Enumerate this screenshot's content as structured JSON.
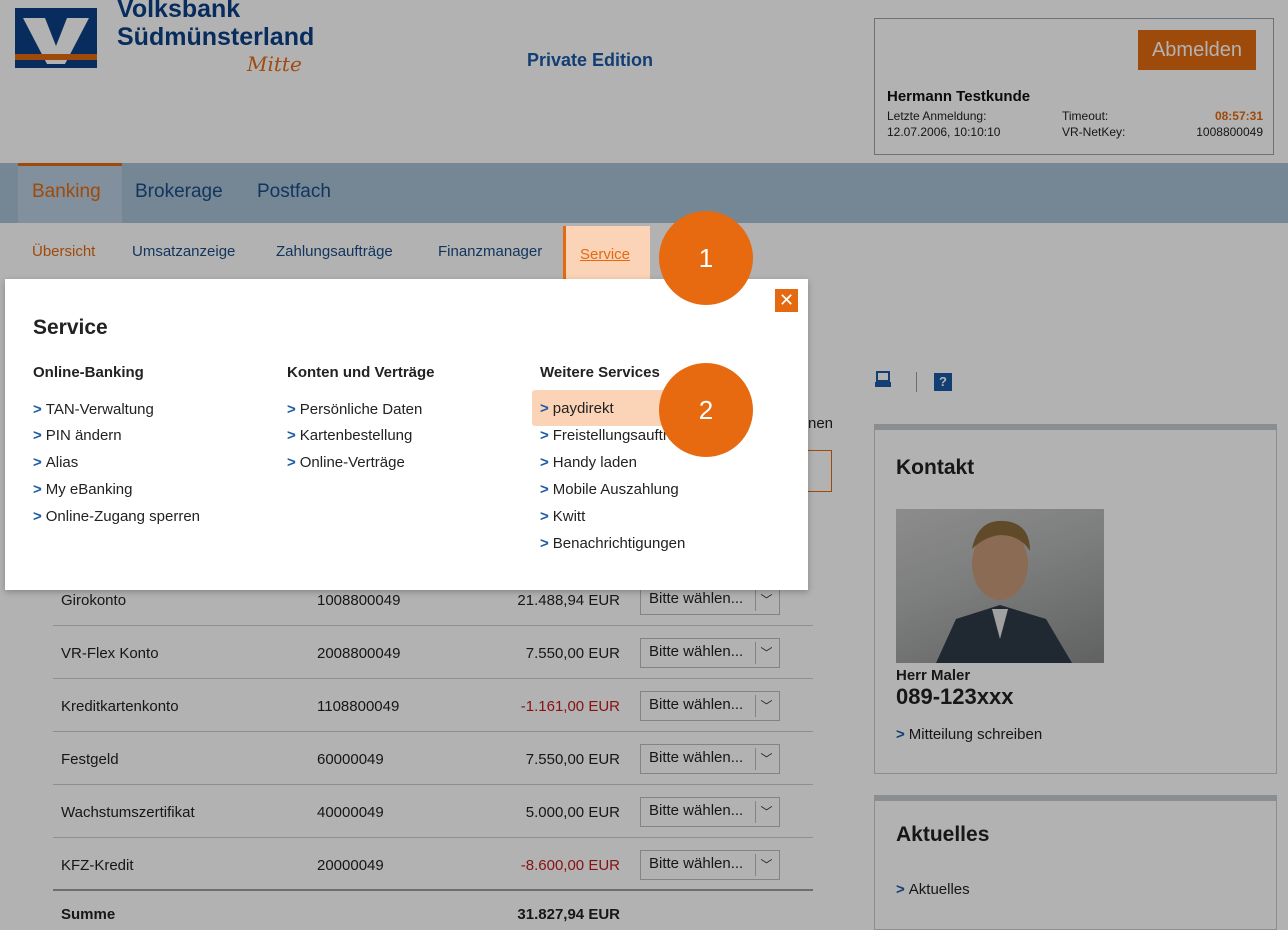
{
  "brand": {
    "line1": "Volksbank",
    "line2": "Südmünsterland",
    "line3": "Mitte",
    "edition": "Private Edition"
  },
  "user": {
    "logout_label": "Abmelden",
    "name": "Hermann Testkunde",
    "last_login_label": "Letzte Anmeldung:",
    "last_login_value": "12.07.2006, 10:10:10",
    "timeout_label": "Timeout:",
    "timeout_value": "08:57:31",
    "netkey_label": "VR-NetKey:",
    "netkey_value": "1008800049"
  },
  "main_nav": [
    "Banking",
    "Brokerage",
    "Postfach"
  ],
  "sub_nav": [
    "Übersicht",
    "Umsatzanzeige",
    "Zahlungsaufträge",
    "Finanzmanager",
    "Service"
  ],
  "callouts": [
    "1",
    "2"
  ],
  "mega_menu": {
    "title": "Service",
    "columns": [
      {
        "heading": "Online-Banking",
        "items": [
          "TAN-Verwaltung",
          "PIN ändern",
          "Alias",
          "My eBanking",
          "Online-Zugang sperren"
        ]
      },
      {
        "heading": "Konten und Verträge",
        "items": [
          "Persönliche Daten",
          "Kartenbestellung",
          "Online-Verträge"
        ]
      },
      {
        "heading": "Weitere Services",
        "items": [
          "paydirekt",
          "Freistellungsaufträge",
          "Handy laden",
          "Mobile Auszahlung",
          "Kwitt",
          "Benachrichtigungen"
        ]
      }
    ]
  },
  "partial_text": "nen",
  "accounts": [
    {
      "name": "Girokonto",
      "number": "1008800049",
      "amount": "21.488,94 EUR",
      "negative": false,
      "action": "Bitte wählen..."
    },
    {
      "name": "VR-Flex Konto",
      "number": "2008800049",
      "amount": "7.550,00 EUR",
      "negative": false,
      "action": "Bitte wählen..."
    },
    {
      "name": "Kreditkartenkonto",
      "number": "1108800049",
      "amount": "-1.161,00 EUR",
      "negative": true,
      "action": "Bitte wählen..."
    },
    {
      "name": "Festgeld",
      "number": "60000049",
      "amount": "7.550,00 EUR",
      "negative": false,
      "action": "Bitte wählen..."
    },
    {
      "name": "Wachstumszertifikat",
      "number": "40000049",
      "amount": "5.000,00 EUR",
      "negative": false,
      "action": "Bitte wählen..."
    },
    {
      "name": "KFZ-Kredit",
      "number": "20000049",
      "amount": "-8.600,00 EUR",
      "negative": true,
      "action": "Bitte wählen..."
    }
  ],
  "sum": {
    "label": "Summe",
    "amount": "31.827,94 EUR"
  },
  "tools": {
    "print_icon": "printer-icon",
    "help_label": "?"
  },
  "contact": {
    "title": "Kontakt",
    "person": "Herr Maler",
    "phone": "089-123xxx",
    "link": "Mitteilung schreiben"
  },
  "news": {
    "title": "Aktuelles",
    "link": "Aktuelles"
  },
  "colors": {
    "accent": "#e36a10",
    "brand_blue": "#0b3f86",
    "nav_bg": "#a8c0d4",
    "highlight": "#fbd3b6",
    "negative": "#c21a1a"
  }
}
